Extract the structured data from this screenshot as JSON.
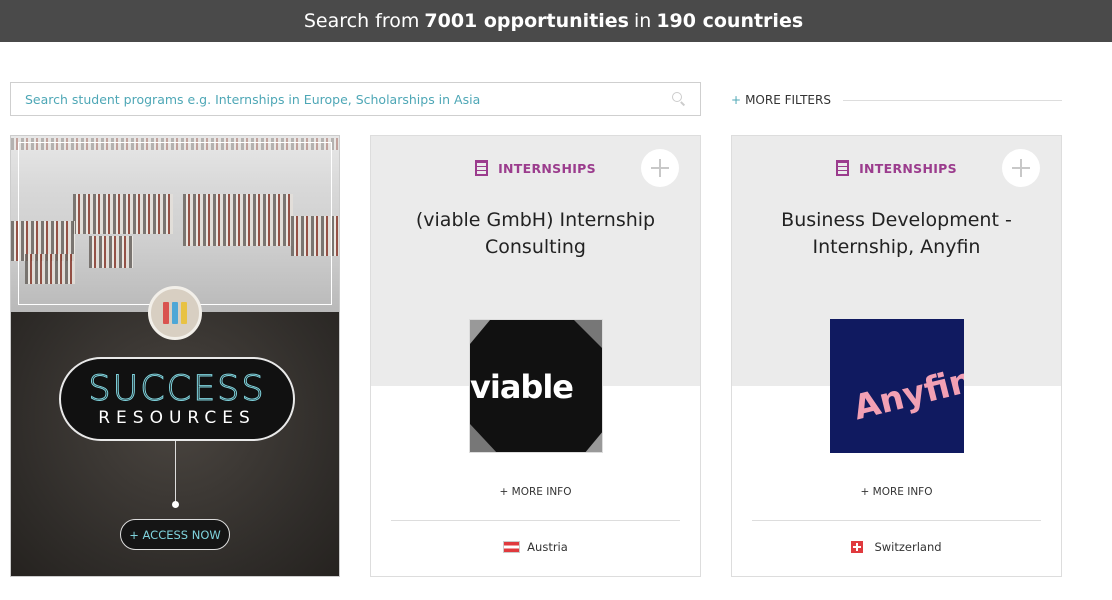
{
  "header": {
    "prefix": "Search from",
    "count": "7001 opportunities",
    "middle": "in",
    "countries": "190 countries"
  },
  "search": {
    "placeholder": "Search student programs e.g. Internships in Europe, Scholarships in Asia"
  },
  "filters": {
    "plus": "+",
    "label": "MORE FILTERS"
  },
  "promo": {
    "title_line1": "SUCCESS",
    "title_line2": "RESOURCES",
    "cta": "+ ACCESS NOW"
  },
  "cards": [
    {
      "category": "INTERNSHIPS",
      "title": "(viable GmbH) Internship Consulting",
      "logo_text": "viable",
      "more_info": "+ MORE INFO",
      "country": "Austria"
    },
    {
      "category": "INTERNSHIPS",
      "title": "Business Development - Internship, Anyfin",
      "logo_text": "Anyfin",
      "more_info": "+ MORE INFO",
      "country": "Switzerland"
    }
  ],
  "colors": {
    "accent": "#4ea7b6",
    "category": "#9b3c8d",
    "topbar": "#4a4a4a",
    "anyfin_bg": "#101a60",
    "anyfin_text": "#f2a0b4"
  },
  "icons": [
    "search-icon",
    "building-icon",
    "plus-icon",
    "binders-icon",
    "austria-flag-icon",
    "switzerland-flag-icon"
  ]
}
